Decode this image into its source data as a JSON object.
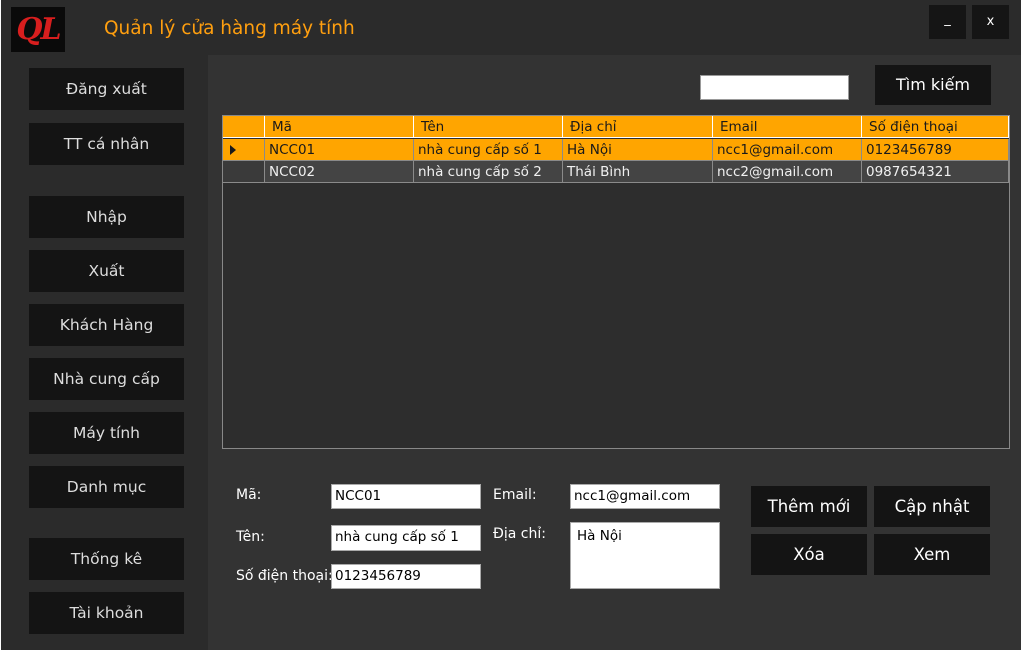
{
  "window": {
    "logo_text": "QL",
    "title": "Quản lý cửa hàng máy tính",
    "minimize_label": "_",
    "close_label": "x"
  },
  "sidebar": {
    "items": [
      {
        "label": "Đăng xuất"
      },
      {
        "label": "TT cá nhân"
      },
      {
        "label": "Nhập"
      },
      {
        "label": "Xuất"
      },
      {
        "label": "Khách Hàng"
      },
      {
        "label": "Nhà cung cấp"
      },
      {
        "label": "Máy tính"
      },
      {
        "label": "Danh mục"
      },
      {
        "label": "Thống kê"
      },
      {
        "label": "Tài khoản"
      }
    ]
  },
  "search": {
    "value": "",
    "button_label": "Tìm kiếm"
  },
  "grid": {
    "columns": [
      "Mã",
      "Tên",
      "Địa chỉ",
      "Email",
      "Số điện thoại"
    ],
    "rows": [
      {
        "cells": [
          "NCC01",
          "nhà cung cấp số 1",
          "Hà Nội",
          "ncc1@gmail.com",
          "0123456789"
        ],
        "selected": true
      },
      {
        "cells": [
          "NCC02",
          "nhà cung cấp số 2",
          "Thái Bình",
          "ncc2@gmail.com",
          "0987654321"
        ],
        "selected": false
      }
    ]
  },
  "form": {
    "ma_label": "Mã:",
    "ma_value": "NCC01",
    "ten_label": "Tên:",
    "ten_value": "nhà cung cấp số 1",
    "sdt_label": "Số điện thoại:",
    "sdt_value": "0123456789",
    "email_label": "Email:",
    "email_value": "ncc1@gmail.com",
    "diachi_label": "Địa chỉ:",
    "diachi_value": "Hà Nội"
  },
  "actions": {
    "add_label": "Thêm mới",
    "update_label": "Cập nhật",
    "delete_label": "Xóa",
    "view_label": "Xem"
  },
  "colors": {
    "accent": "#ffa500",
    "title_text": "#ff9f0f",
    "logo_text": "#d81e1e",
    "button_bg": "#141414",
    "panel_bg": "#333333",
    "sidebar_bg": "#2b2b2b"
  }
}
